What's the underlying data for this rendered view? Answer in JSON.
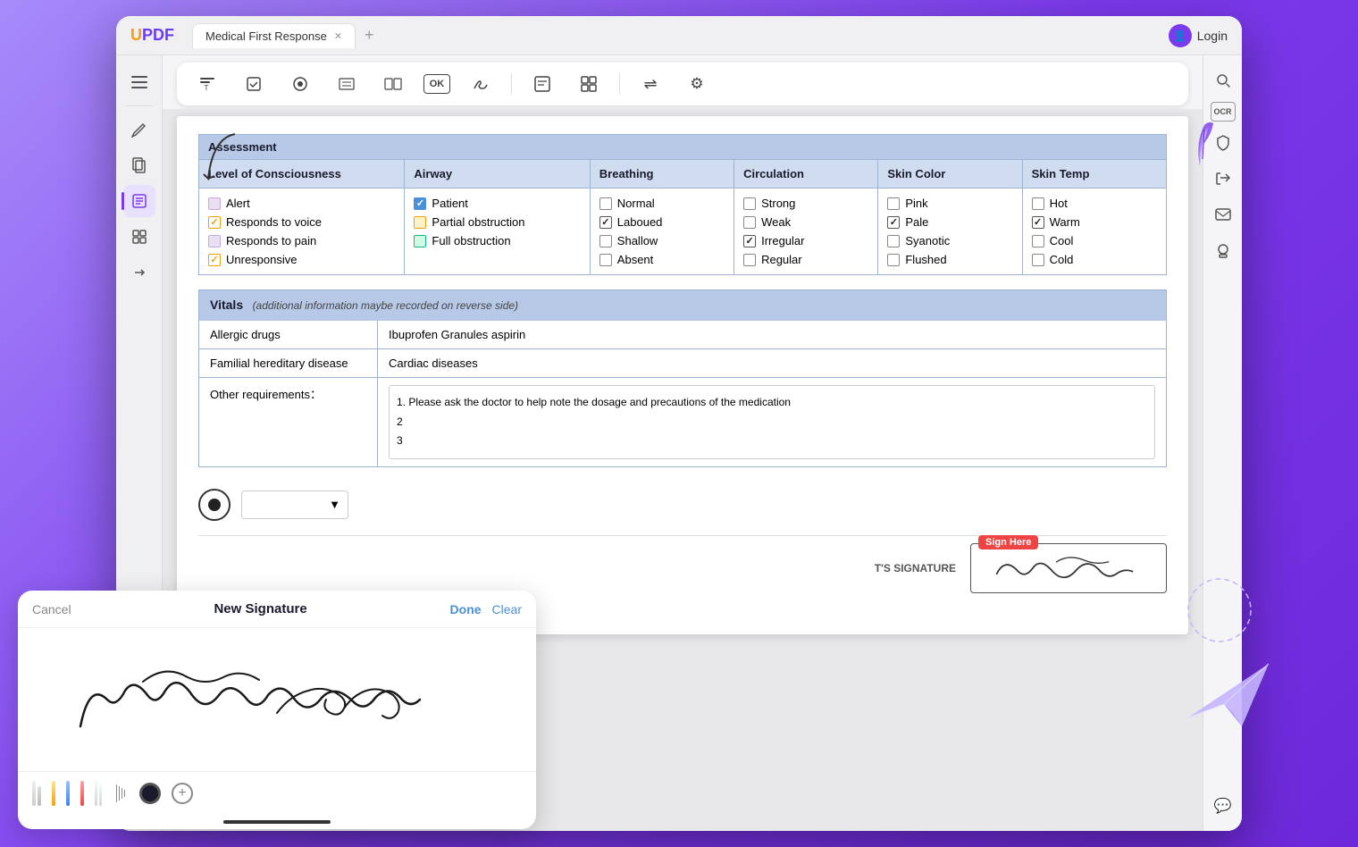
{
  "app": {
    "logo": "UPDF",
    "logo_accent": "U",
    "tab_title": "Medical First Response",
    "login_label": "Login"
  },
  "toolbar": {
    "buttons": [
      {
        "id": "text-insert",
        "icon": "T↓",
        "label": "Insert Text"
      },
      {
        "id": "checkbox",
        "icon": "☑",
        "label": "Checkbox"
      },
      {
        "id": "radio",
        "icon": "◉",
        "label": "Radio"
      },
      {
        "id": "list",
        "icon": "≡↓",
        "label": "List"
      },
      {
        "id": "table",
        "icon": "⊞",
        "label": "Table"
      },
      {
        "id": "ok-btn",
        "icon": "OK",
        "label": "OK Button"
      },
      {
        "id": "sign",
        "icon": "✍",
        "label": "Signature"
      },
      {
        "id": "form",
        "icon": "≣",
        "label": "Form"
      },
      {
        "id": "grid",
        "icon": "⊞⊞",
        "label": "Grid"
      },
      {
        "id": "align",
        "icon": "≡↔",
        "label": "Align"
      },
      {
        "id": "settings",
        "icon": "⚙",
        "label": "Settings"
      }
    ]
  },
  "assessment": {
    "title": "Assessment",
    "columns": {
      "consciousness": "Level of Consciousness",
      "airway": "Airway",
      "breathing": "Breathing",
      "circulation": "Circulation",
      "skin_color": "Skin Color",
      "skin_temp": "Skin Temp"
    },
    "consciousness_options": [
      {
        "label": "Alert",
        "checked": false,
        "type": "purple"
      },
      {
        "label": "Responds to voice",
        "checked": true,
        "type": "orange"
      },
      {
        "label": "Responds to pain",
        "checked": false,
        "type": "purple"
      },
      {
        "label": "Unresponsive",
        "checked": false,
        "type": "orange"
      }
    ],
    "airway_options": [
      {
        "label": "Patient",
        "checked": true,
        "type": "blue"
      },
      {
        "label": "Partial obstruction",
        "checked": false,
        "type": "orange"
      },
      {
        "label": "Full obstruction",
        "checked": false,
        "type": "green"
      }
    ],
    "breathing_options": [
      {
        "label": "Normal",
        "checked": false
      },
      {
        "label": "Laboued",
        "checked": true
      },
      {
        "label": "Shallow",
        "checked": false
      },
      {
        "label": "Absent",
        "checked": false
      }
    ],
    "circulation_options": [
      {
        "label": "Strong",
        "checked": false
      },
      {
        "label": "Weak",
        "checked": false
      },
      {
        "label": "Irregular",
        "checked": true
      },
      {
        "label": "Regular",
        "checked": false
      }
    ],
    "skin_color_options": [
      {
        "label": "Pink",
        "checked": false
      },
      {
        "label": "Pale",
        "checked": true
      },
      {
        "label": "Syanotic",
        "checked": false
      },
      {
        "label": "Flushed",
        "checked": false
      }
    ],
    "skin_temp_options": [
      {
        "label": "Hot",
        "checked": false
      },
      {
        "label": "Warm",
        "checked": true
      },
      {
        "label": "Cool",
        "checked": false
      },
      {
        "label": "Cold",
        "checked": false
      }
    ]
  },
  "vitals": {
    "title": "Vitals",
    "note": "(additional information maybe recorded on reverse side)",
    "allergic_label": "Allergic drugs",
    "allergic_value": "Ibuprofen Granules  aspirin",
    "hereditary_label": "Familial hereditary disease",
    "hereditary_value": "Cardiac diseases",
    "other_label": "Other requirements：",
    "other_lines": [
      "1. Please ask the doctor to help note the dosage and precautions of the medication",
      "2",
      "3"
    ]
  },
  "signature": {
    "label": "T'S SIGNATURE",
    "sign_here": "Sign Here",
    "signature_text": "Richard Nixon"
  },
  "modal": {
    "cancel_label": "Cancel",
    "title": "New Signature",
    "done_label": "Done",
    "clear_label": "Clear",
    "signature_text": "Richard Nixon"
  },
  "sidebar": {
    "icons": [
      "≡",
      "✎",
      "⊞",
      "☑",
      "⊡",
      "⊟"
    ]
  },
  "right_sidebar": {
    "icons": [
      "🔍",
      "⊞",
      "⊡",
      "⬆",
      "✉",
      "⊙",
      "💬"
    ]
  }
}
